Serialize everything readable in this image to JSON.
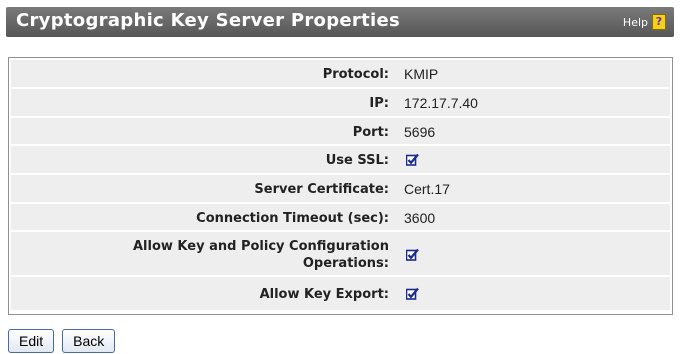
{
  "header": {
    "title": "Cryptographic Key Server Properties",
    "help_label": "Help",
    "help_icon": "help-question-icon"
  },
  "properties": [
    {
      "label": "Protocol:",
      "value": "KMIP"
    },
    {
      "label": "IP:",
      "value": "172.17.7.40"
    },
    {
      "label": "Port:",
      "value": "5696"
    },
    {
      "label": "Use SSL:",
      "checked": true
    },
    {
      "label": "Server Certificate:",
      "value": "Cert.17"
    },
    {
      "label": "Connection Timeout (sec):",
      "value": "3600"
    },
    {
      "label_line1": "Allow Key and Policy Configuration",
      "label_line2": "Operations:",
      "checked": true
    },
    {
      "label": "Allow Key Export:",
      "checked": true
    }
  ],
  "buttons": {
    "edit": "Edit",
    "back": "Back"
  },
  "colors": {
    "titlebar": "#666666",
    "row_bg": "#eeeeee",
    "check": "#1a2a8a"
  }
}
